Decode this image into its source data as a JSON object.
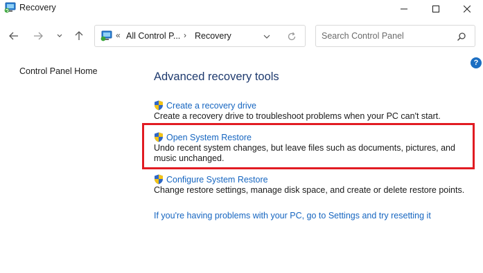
{
  "window": {
    "title": "Recovery",
    "controls": {
      "minimize": "minimize-icon",
      "maximize": "maximize-icon",
      "close": "close-icon"
    }
  },
  "navbar": {
    "address": {
      "chevrons": "«",
      "crumb1": "All Control P...",
      "separator": "›",
      "crumb2": "Recovery"
    },
    "search": {
      "placeholder": "Search Control Panel"
    }
  },
  "left_pane": {
    "home_link": "Control Panel Home"
  },
  "help": {
    "label": "?"
  },
  "main": {
    "heading": "Advanced recovery tools",
    "tools": [
      {
        "label": "Create a recovery drive",
        "description": "Create a recovery drive to troubleshoot problems when your PC can't start."
      },
      {
        "label": "Open System Restore",
        "description": "Undo recent system changes, but leave files such as documents, pictures, and music unchanged."
      },
      {
        "label": "Configure System Restore",
        "description": "Change restore settings, manage disk space, and create or delete restore points."
      }
    ],
    "reset_link": "If you're having problems with your PC, go to Settings and try resetting it"
  },
  "colors": {
    "accent_link": "#1565c0",
    "heading": "#1e3a6e",
    "highlight": "#e11b22",
    "help": "#1b6ec2"
  }
}
